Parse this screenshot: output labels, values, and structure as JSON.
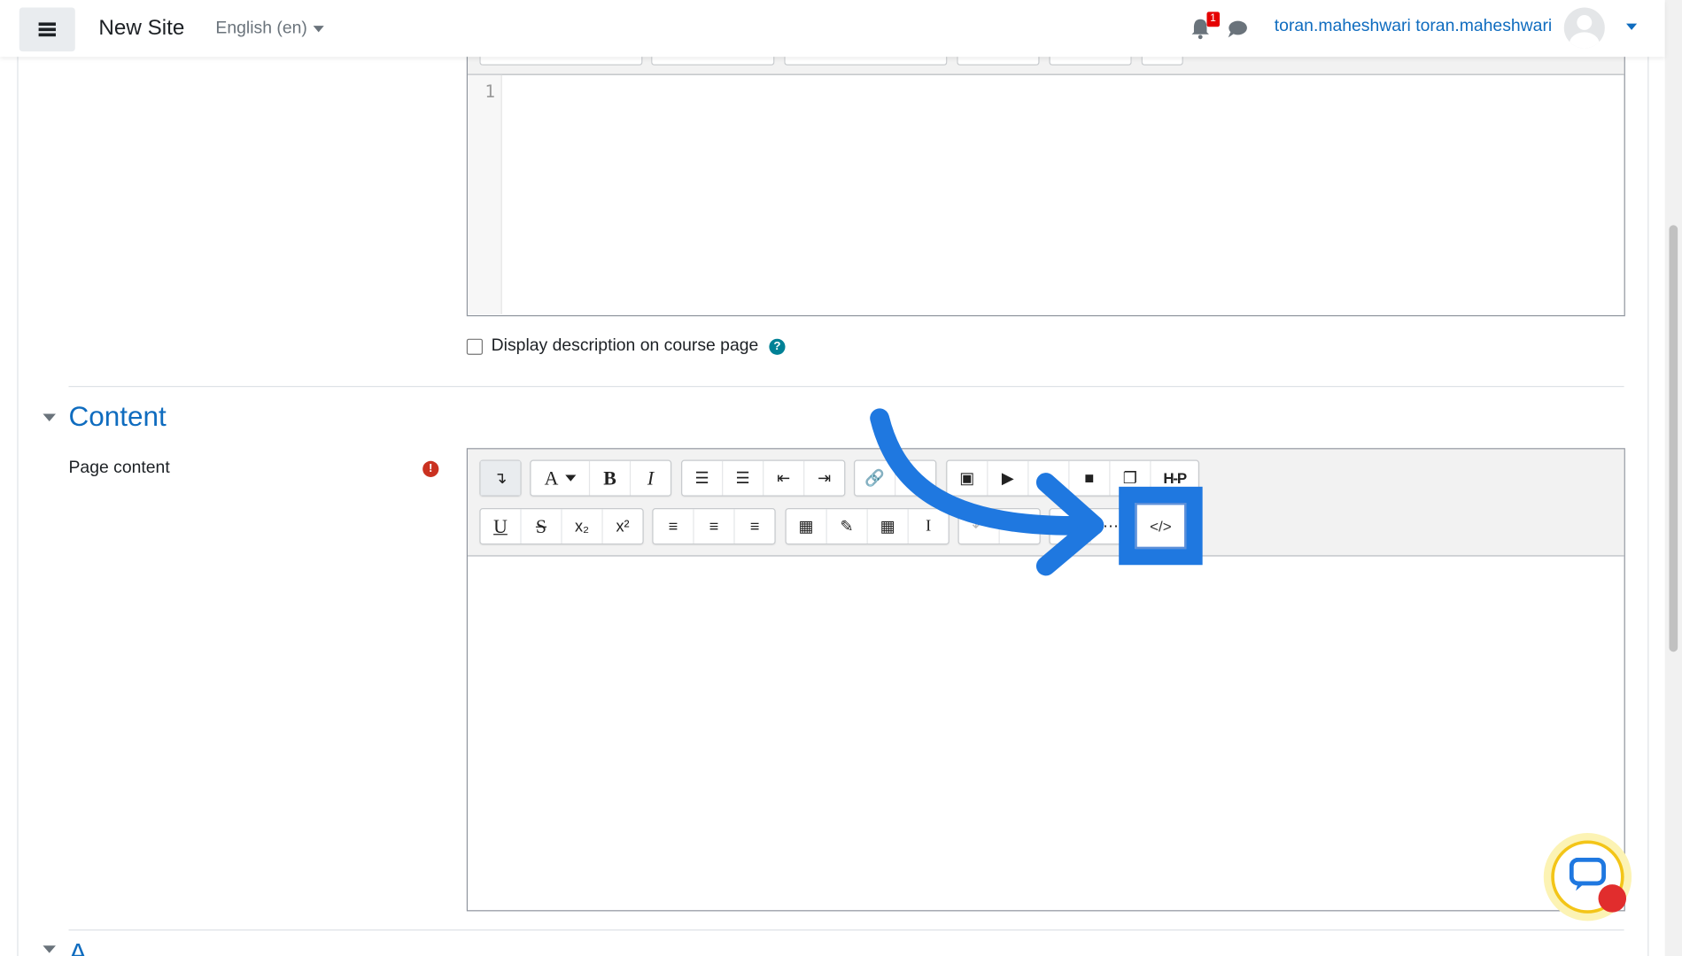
{
  "navbar": {
    "site_name": "New Site",
    "language": "English (en)",
    "notification_count": "1",
    "username": "toran.maheshwari toran.maheshwari"
  },
  "description": {
    "line_number": "1",
    "display_checkbox_label": "Display description on course page",
    "display_checked": false
  },
  "content": {
    "section_title": "Content",
    "page_content_label": "Page content",
    "next_section_partial": "A"
  },
  "toolbar": {
    "row1": [
      "show-more-buttons",
      "paragraph-styles",
      "bold",
      "italic",
      "unordered-list",
      "ordered-list",
      "outdent",
      "indent",
      "link",
      "unlink",
      "image",
      "media",
      "record-audio",
      "record-video",
      "manage-files",
      "h5p"
    ],
    "row2": [
      "underline",
      "strikethrough",
      "subscript",
      "superscript",
      "align-left",
      "align-center",
      "align-right",
      "equation",
      "special-character",
      "table",
      "clear-formatting",
      "undo",
      "redo",
      "accessibility-checker",
      "screenreader-helper",
      "html-source"
    ],
    "h5p_label": "H-P"
  },
  "colors": {
    "accent": "#0f6cbf",
    "annotation_blue": "#1f78e0",
    "required": "#ca3120",
    "help": "#008196"
  }
}
